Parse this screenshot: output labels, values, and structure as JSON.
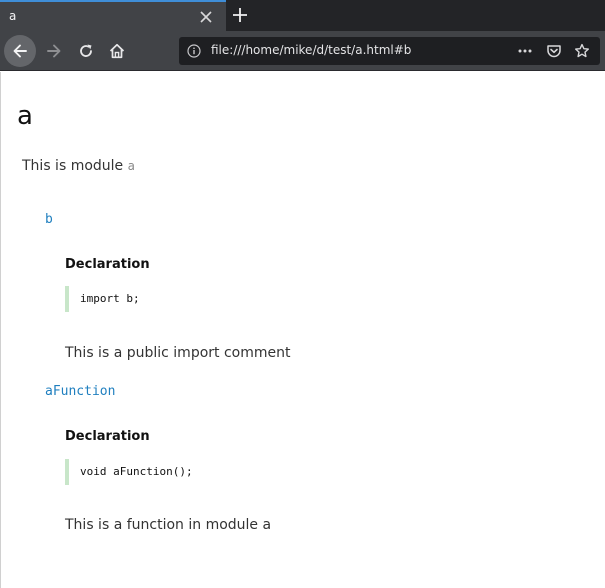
{
  "browser": {
    "tab": {
      "title": "a"
    },
    "url": "file:///home/mike/d/test/a.html#b"
  },
  "page": {
    "title": "a",
    "module_line": {
      "prefix": "This is module ",
      "module_name": "a"
    },
    "symbols": [
      {
        "name": "b",
        "declaration_heading": "Declaration",
        "code": "import b;",
        "comment": "This is a public import comment"
      },
      {
        "name": "aFunction",
        "declaration_heading": "Declaration",
        "code": "void aFunction();",
        "comment": "This is a function in module a"
      }
    ]
  },
  "colors": {
    "link": "#1f7fbf",
    "code_border": "#c8e6c9",
    "tab_accent": "#3f8ed8"
  }
}
